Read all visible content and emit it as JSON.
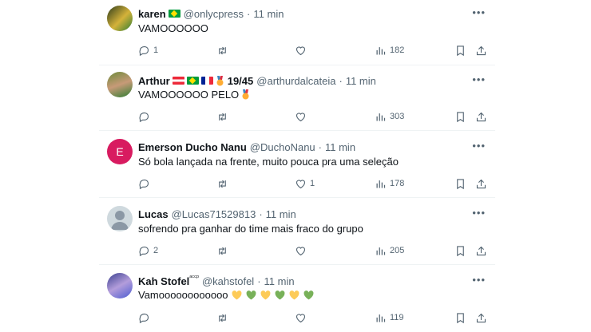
{
  "colors": {
    "name": "#0f1419",
    "meta": "#536471",
    "divider": "#eff3f4",
    "avatar_e": "#d81b60",
    "heart_yellow": "#fdcb58",
    "heart_green": "#78b159"
  },
  "tweets": [
    {
      "name": "karen",
      "flags": [
        "br"
      ],
      "handle": "@onlycpress",
      "time": "11 min",
      "text": "VAMOOOOOO",
      "replies": "1",
      "retweets": "",
      "likes": "",
      "views": "182"
    },
    {
      "name": "Arthur",
      "flags": [
        "at",
        "br",
        "fr"
      ],
      "extra": "19/45",
      "handle": "@arthurdalcateia",
      "time": "11 min",
      "text": "VAMOOOOOO PELO",
      "replies": "",
      "retweets": "",
      "likes": "",
      "views": "303"
    },
    {
      "name": "Emerson Ducho Nanu",
      "flags": [],
      "handle": "@DuchoNanu",
      "time": "11 min",
      "text": "Só bola lançada na frente, muito pouca pra uma seleção",
      "replies": "",
      "retweets": "",
      "likes": "1",
      "views": "178",
      "avatar_letter": "E"
    },
    {
      "name": "Lucas",
      "flags": [],
      "handle": "@Lucas71529813",
      "time": "11 min",
      "text": "sofrendo pra ganhar do time mais fraco do grupo",
      "replies": "2",
      "retweets": "",
      "likes": "",
      "views": "205"
    },
    {
      "name": "Kah Stofel",
      "suffix": "ᵃᶜᶜᵖ",
      "flags": [],
      "handle": "@kahstofel",
      "time": "11 min",
      "text": "Vamoooooooooooo",
      "replies": "",
      "retweets": "",
      "likes": "",
      "views": "119"
    }
  ],
  "separator": "·",
  "more_label": "•••"
}
